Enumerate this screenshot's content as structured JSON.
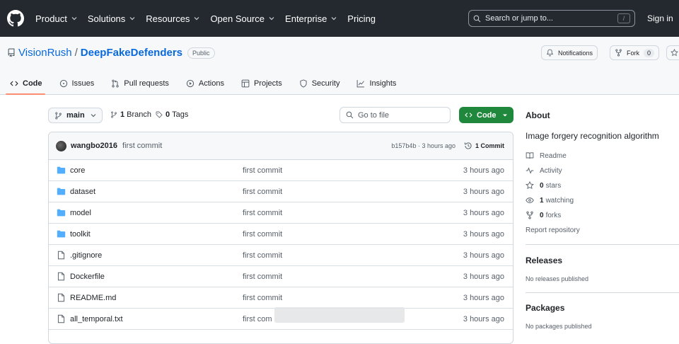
{
  "global_nav": {
    "items": [
      "Product",
      "Solutions",
      "Resources",
      "Open Source",
      "Enterprise",
      "Pricing"
    ],
    "search_placeholder": "Search or jump to...",
    "search_shortcut": "/",
    "sign_in": "Sign in"
  },
  "repo": {
    "owner": "VisionRush",
    "separator": "/",
    "name": "DeepFakeDefenders",
    "visibility": "Public",
    "notifications_label": "Notifications",
    "fork_label": "Fork",
    "fork_count": "0"
  },
  "tabs": [
    {
      "label": "Code",
      "icon": "code-icon",
      "active": true
    },
    {
      "label": "Issues",
      "icon": "issue-icon",
      "active": false
    },
    {
      "label": "Pull requests",
      "icon": "pull-request-icon",
      "active": false
    },
    {
      "label": "Actions",
      "icon": "play-icon",
      "active": false
    },
    {
      "label": "Projects",
      "icon": "table-icon",
      "active": false
    },
    {
      "label": "Security",
      "icon": "shield-icon",
      "active": false
    },
    {
      "label": "Insights",
      "icon": "graph-icon",
      "active": false
    }
  ],
  "toolbar": {
    "branch": "main",
    "branch_count": "1",
    "branch_label": "Branch",
    "tag_count": "0",
    "tag_label": "Tags",
    "go_to_file": "Go to file",
    "code_button": "Code"
  },
  "latest_commit": {
    "author": "wangbo2016",
    "message": "first commit",
    "hash_time": "b157b4b · 3 hours ago",
    "commit_count": "1 Commit"
  },
  "files": [
    {
      "name": "core",
      "type": "folder",
      "message": "first commit",
      "time": "3 hours ago"
    },
    {
      "name": "dataset",
      "type": "folder",
      "message": "first commit",
      "time": "3 hours ago"
    },
    {
      "name": "model",
      "type": "folder",
      "message": "first commit",
      "time": "3 hours ago"
    },
    {
      "name": "toolkit",
      "type": "folder",
      "message": "first commit",
      "time": "3 hours ago"
    },
    {
      "name": ".gitignore",
      "type": "file",
      "message": "first commit",
      "time": "3 hours ago"
    },
    {
      "name": "Dockerfile",
      "type": "file",
      "message": "first commit",
      "time": "3 hours ago"
    },
    {
      "name": "README.md",
      "type": "file",
      "message": "first commit",
      "time": "3 hours ago"
    },
    {
      "name": "all_temporal.txt",
      "type": "file",
      "message": "first com",
      "time": "3 hours ago"
    }
  ],
  "about": {
    "title": "About",
    "description": "Image forgery recognition algorithm",
    "readme": "Readme",
    "activity": "Activity",
    "stars_count": "0",
    "stars_label": "stars",
    "watching_count": "1",
    "watching_label": "watching",
    "forks_count": "0",
    "forks_label": "forks",
    "report": "Report repository"
  },
  "releases": {
    "title": "Releases",
    "empty": "No releases published"
  },
  "packages": {
    "title": "Packages",
    "empty": "No packages published"
  },
  "colors": {
    "header_bg": "#24292f",
    "link": "#0969da",
    "primary_button": "#1f883d",
    "active_tab_underline": "#fd8c73",
    "folder": "#54aeff"
  }
}
